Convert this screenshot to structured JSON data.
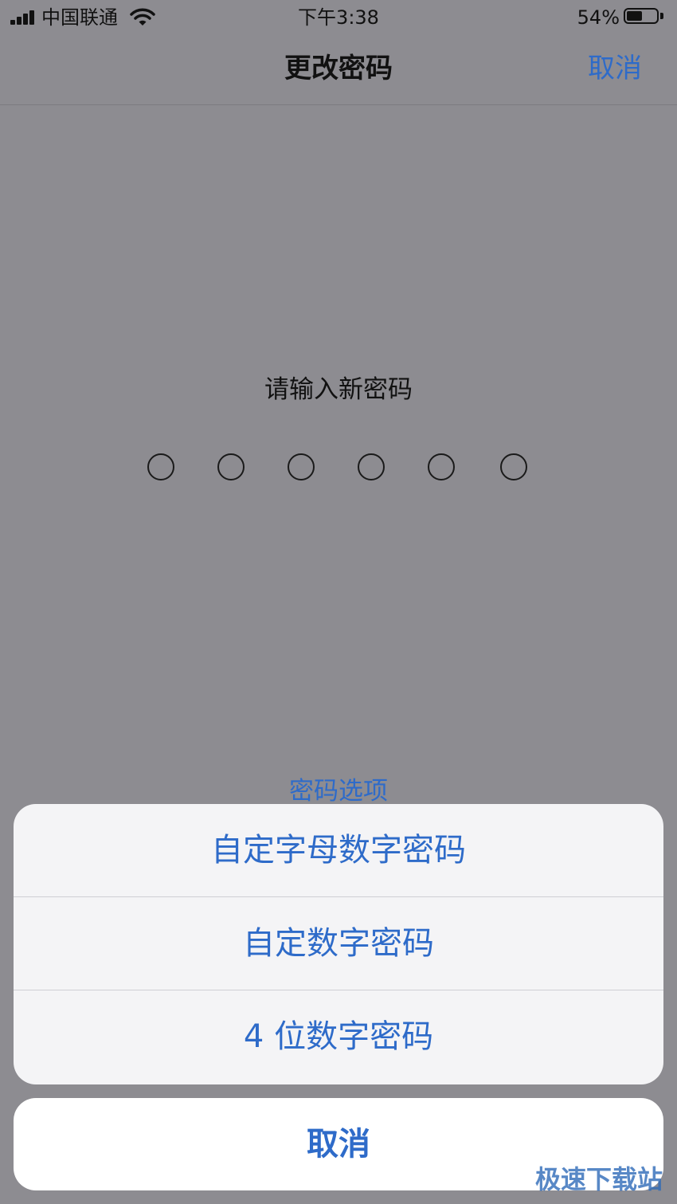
{
  "status_bar": {
    "carrier": "中国联通",
    "time": "下午3:38",
    "battery_percent_label": "54%",
    "battery_level": 0.54,
    "icons": [
      "signal-bars-icon",
      "wifi-icon",
      "battery-icon"
    ]
  },
  "nav": {
    "title": "更改密码",
    "cancel_label": "取消"
  },
  "passcode": {
    "prompt": "请输入新密码",
    "digit_count": 6,
    "filled_count": 0
  },
  "options_link": "密码选项",
  "action_sheet": {
    "items": [
      {
        "label": "自定字母数字密码"
      },
      {
        "label": "自定数字密码"
      },
      {
        "label": "4 位数字密码"
      }
    ],
    "cancel_label": "取消"
  },
  "watermark": "极速下载站",
  "colors": {
    "accent": "#2e6bc9",
    "dimmed_background": "#8d8c91",
    "sheet_background": "#f4f4f6"
  }
}
